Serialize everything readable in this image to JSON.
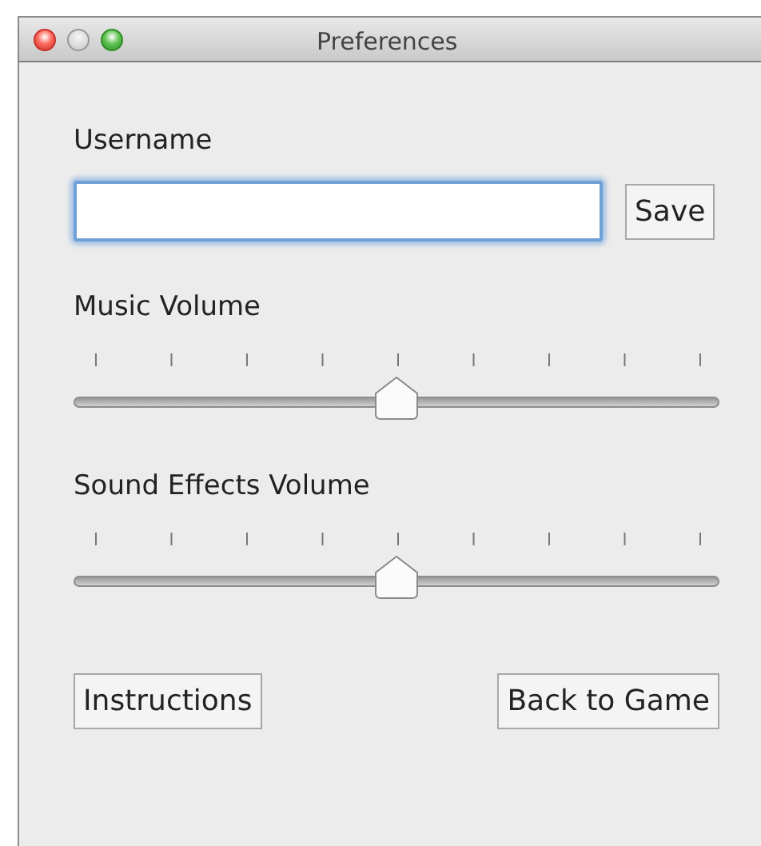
{
  "window": {
    "title": "Preferences",
    "controls": [
      {
        "kind": "close",
        "disabled": false
      },
      {
        "kind": "minimize",
        "disabled": true
      },
      {
        "kind": "zoom",
        "disabled": false
      }
    ]
  },
  "username": {
    "label": "Username",
    "focused": true,
    "button": "Save"
  },
  "sliders": [
    {
      "label": "Music Volume",
      "level": 0.5
    },
    {
      "label": "Sound Effects Volume",
      "level": 0.5
    }
  ],
  "buttons": [
    "Instructions",
    "Back to Game"
  ]
}
